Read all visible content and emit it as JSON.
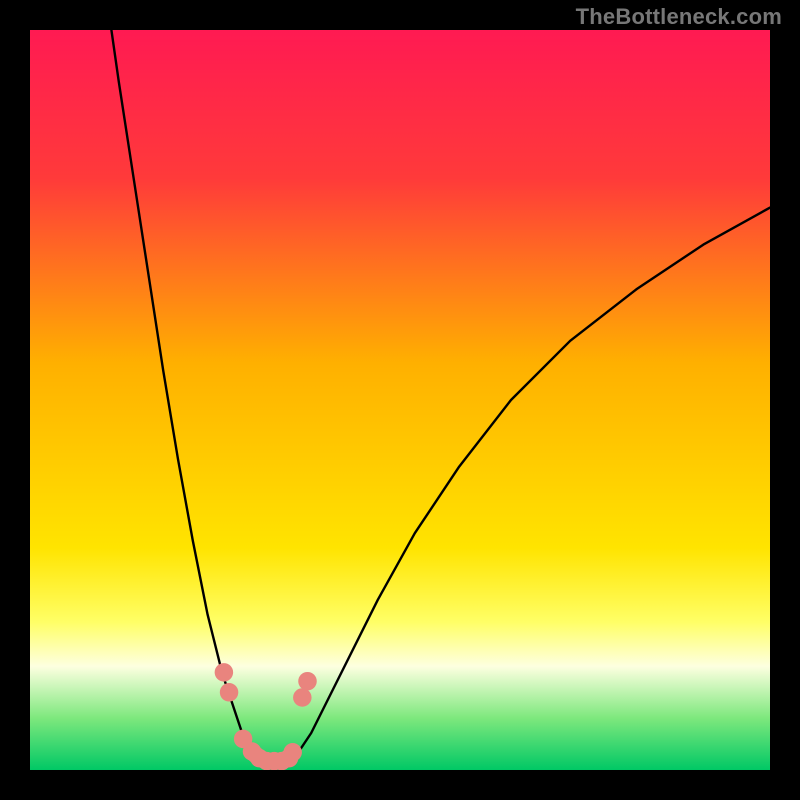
{
  "watermark": "TheBottleneck.com",
  "chart_data": {
    "type": "line",
    "title": "",
    "xlabel": "",
    "ylabel": "",
    "xlim": [
      0,
      100
    ],
    "ylim": [
      0,
      100
    ],
    "background_gradient": {
      "stops": [
        {
          "pos": 0.0,
          "color": "#ff1a52"
        },
        {
          "pos": 0.2,
          "color": "#ff3a3a"
        },
        {
          "pos": 0.45,
          "color": "#ffb000"
        },
        {
          "pos": 0.7,
          "color": "#ffe400"
        },
        {
          "pos": 0.8,
          "color": "#ffff66"
        },
        {
          "pos": 0.86,
          "color": "#fdffe0"
        },
        {
          "pos": 0.93,
          "color": "#7de87d"
        },
        {
          "pos": 1.0,
          "color": "#00c865"
        }
      ]
    },
    "series": [
      {
        "name": "curve-left",
        "x": [
          11,
          12,
          14,
          16,
          18,
          20,
          22,
          24,
          25,
          26,
          27,
          28,
          29,
          30,
          31
        ],
        "y": [
          100,
          93,
          80,
          67,
          54,
          42,
          31,
          21,
          17,
          13,
          10,
          7,
          4,
          2,
          1
        ]
      },
      {
        "name": "curve-right",
        "x": [
          35,
          36,
          38,
          40,
          43,
          47,
          52,
          58,
          65,
          73,
          82,
          91,
          100
        ],
        "y": [
          1,
          2,
          5,
          9,
          15,
          23,
          32,
          41,
          50,
          58,
          65,
          71,
          76
        ]
      },
      {
        "name": "valley-base",
        "x": [
          30,
          31,
          32,
          33,
          34,
          35,
          35.5
        ],
        "y": [
          2.5,
          1.6,
          1.2,
          1.2,
          1.2,
          1.6,
          2.4
        ]
      }
    ],
    "markers": {
      "color": "#e9847e",
      "radius_pct": 1.25,
      "points": [
        {
          "x": 26.2,
          "y": 13.2
        },
        {
          "x": 26.9,
          "y": 10.5
        },
        {
          "x": 28.8,
          "y": 4.2
        },
        {
          "x": 30.0,
          "y": 2.5
        },
        {
          "x": 31.0,
          "y": 1.6
        },
        {
          "x": 32.0,
          "y": 1.2
        },
        {
          "x": 33.0,
          "y": 1.2
        },
        {
          "x": 34.0,
          "y": 1.2
        },
        {
          "x": 35.0,
          "y": 1.6
        },
        {
          "x": 35.5,
          "y": 2.4
        },
        {
          "x": 36.8,
          "y": 9.8
        },
        {
          "x": 37.5,
          "y": 12.0
        }
      ]
    }
  }
}
